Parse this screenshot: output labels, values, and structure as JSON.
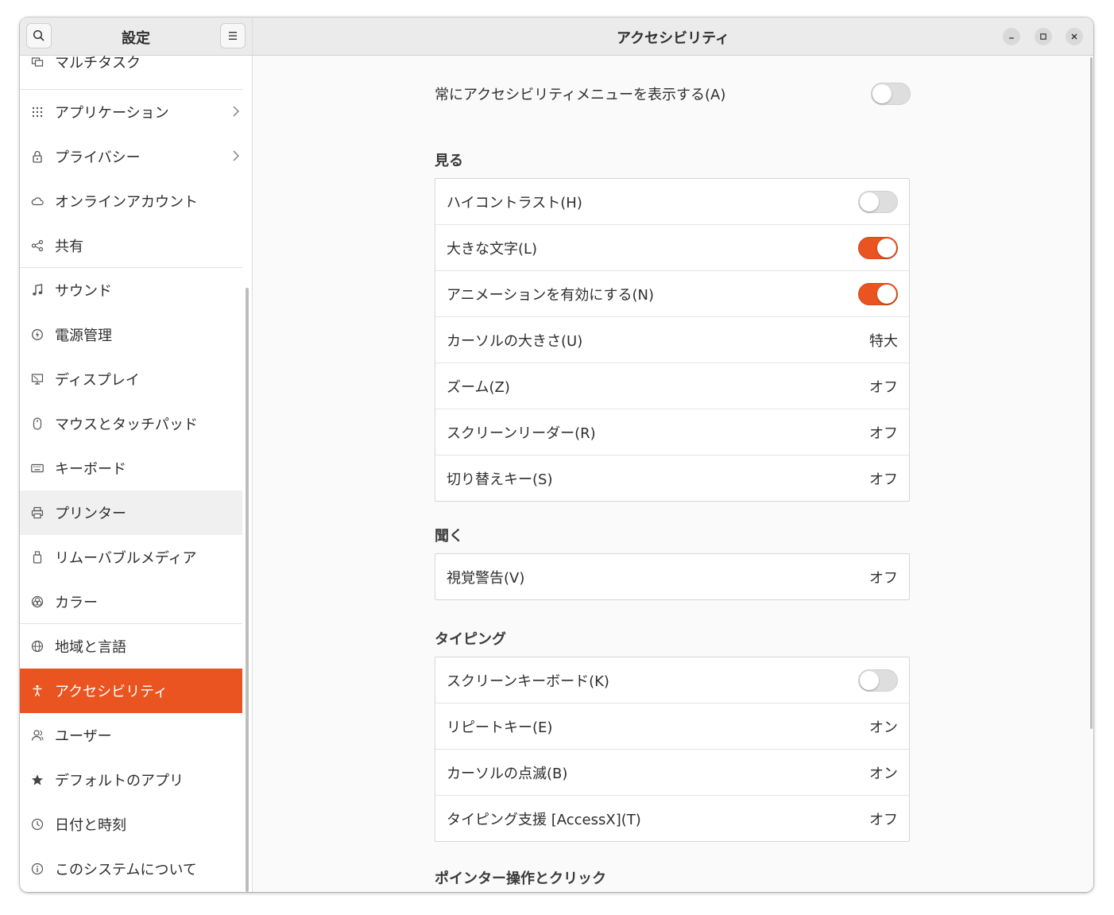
{
  "sidebar": {
    "title": "設定",
    "items": [
      {
        "label": "マルチタスク",
        "icon": "multitask-icon"
      },
      {
        "label": "アプリケーション",
        "icon": "apps-grid-icon",
        "chevron": true
      },
      {
        "label": "プライバシー",
        "icon": "lock-icon",
        "chevron": true
      },
      {
        "label": "オンラインアカウント",
        "icon": "cloud-icon"
      },
      {
        "label": "共有",
        "icon": "share-icon"
      },
      {
        "label": "サウンド",
        "icon": "music-note-icon"
      },
      {
        "label": "電源管理",
        "icon": "power-icon"
      },
      {
        "label": "ディスプレイ",
        "icon": "display-icon"
      },
      {
        "label": "マウスとタッチパッド",
        "icon": "mouse-icon"
      },
      {
        "label": "キーボード",
        "icon": "keyboard-icon"
      },
      {
        "label": "プリンター",
        "icon": "printer-icon"
      },
      {
        "label": "リムーバブルメディア",
        "icon": "removable-media-icon"
      },
      {
        "label": "カラー",
        "icon": "color-icon"
      },
      {
        "label": "地域と言語",
        "icon": "globe-icon"
      },
      {
        "label": "アクセシビリティ",
        "icon": "accessibility-icon",
        "active": true
      },
      {
        "label": "ユーザー",
        "icon": "users-icon"
      },
      {
        "label": "デフォルトのアプリ",
        "icon": "star-icon"
      },
      {
        "label": "日付と時刻",
        "icon": "clock-icon"
      },
      {
        "label": "このシステムについて",
        "icon": "info-icon"
      }
    ]
  },
  "header": {
    "title": "アクセシビリティ"
  },
  "colors": {
    "accent": "#e95420"
  },
  "main": {
    "always_menu": {
      "label": "常にアクセシビリティメニューを表示する(A)",
      "on": false
    },
    "sections": [
      {
        "title": "見る",
        "rows": [
          {
            "label": "ハイコントラスト(H)",
            "toggle": false
          },
          {
            "label": "大きな文字(L)",
            "toggle": true
          },
          {
            "label": "アニメーションを有効にする(N)",
            "toggle": true
          },
          {
            "label": "カーソルの大きさ(U)",
            "value": "特大"
          },
          {
            "label": "ズーム(Z)",
            "value": "オフ"
          },
          {
            "label": "スクリーンリーダー(R)",
            "value": "オフ"
          },
          {
            "label": "切り替えキー(S)",
            "value": "オフ"
          }
        ]
      },
      {
        "title": "聞く",
        "rows": [
          {
            "label": "視覚警告(V)",
            "value": "オフ"
          }
        ]
      },
      {
        "title": "タイピング",
        "rows": [
          {
            "label": "スクリーンキーボード(K)",
            "toggle": false
          },
          {
            "label": "リピートキー(E)",
            "value": "オン"
          },
          {
            "label": "カーソルの点滅(B)",
            "value": "オン"
          },
          {
            "label": "タイピング支援 [AccessX](T)",
            "value": "オフ"
          }
        ]
      },
      {
        "title": "ポインター操作とクリック",
        "rows": []
      }
    ]
  }
}
